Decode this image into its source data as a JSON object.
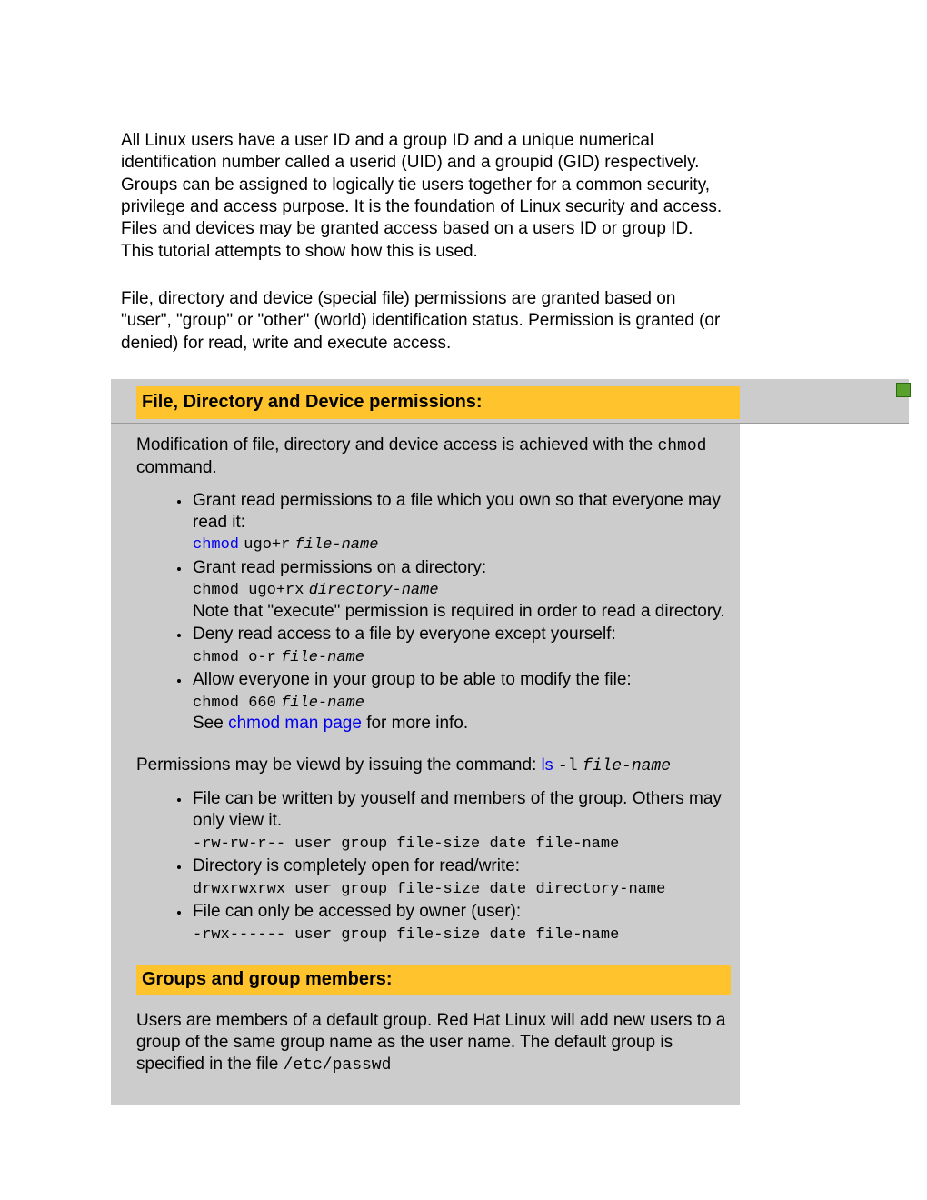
{
  "intro": {
    "p1": "All Linux users have a user ID and a group ID and a unique numerical identification number called a userid (UID) and a groupid (GID) respectively. Groups can be assigned to logically tie users together for a common security, privilege and access purpose. It is the foundation of Linux security and access. Files and devices may be granted access based on a users ID or group ID. This tutorial attempts to show how this is used.",
    "p2": "File, directory and device (special file) permissions are granted based on \"user\", \"group\" or \"other\" (world) identification status. Permission is granted (or denied) for read, write and execute access."
  },
  "section1": {
    "heading": "File, Directory and Device permissions:",
    "lead_pre": "Modification of file, directory and device access is achieved with the ",
    "lead_code": "chmod",
    "lead_post": " command.",
    "items": [
      {
        "text": "Grant read permissions to a file which you own so that everyone may read it:",
        "cmd_link": "chmod",
        "cmd_rest": "ugo+r",
        "cmd_arg": "file-name"
      },
      {
        "text": "Grant read permissions on a directory:",
        "cmd_plain": "chmod ugo+rx",
        "cmd_arg": "directory-name",
        "note": "Note that \"execute\" permission is required in order to read a directory."
      },
      {
        "text": "Deny read access to a file by everyone except yourself:",
        "cmd_plain": "chmod o-r",
        "cmd_arg": "file-name"
      },
      {
        "text": "Allow everyone in your group to be able to modify the file:",
        "cmd_plain": "chmod 660",
        "cmd_arg": "file-name",
        "see_pre": "See ",
        "see_link": "chmod man page",
        "see_post": " for more info."
      }
    ],
    "perm_line_pre": "Permissions may be viewd by issuing the command: ",
    "perm_cmd_link": "ls",
    "perm_cmd_rest": "-l",
    "perm_cmd_arg": "file-name",
    "perm_items": [
      {
        "text": "File can be written by youself and members of the group. Others may only view it.",
        "out": "-rw-rw-r-- user group file-size date file-name"
      },
      {
        "text": "Directory is completely open for read/write:",
        "out": "drwxrwxrwx user group file-size date directory-name"
      },
      {
        "text": "File can only be accessed by owner (user):",
        "out": "-rwx------ user group file-size date file-name"
      }
    ]
  },
  "section2": {
    "heading": "Groups and group members:",
    "p_pre": "Users are members of a default group. Red Hat Linux will add new users to a group of the same group name as the user name. The default group is specified in the file ",
    "p_code": "/etc/passwd"
  }
}
